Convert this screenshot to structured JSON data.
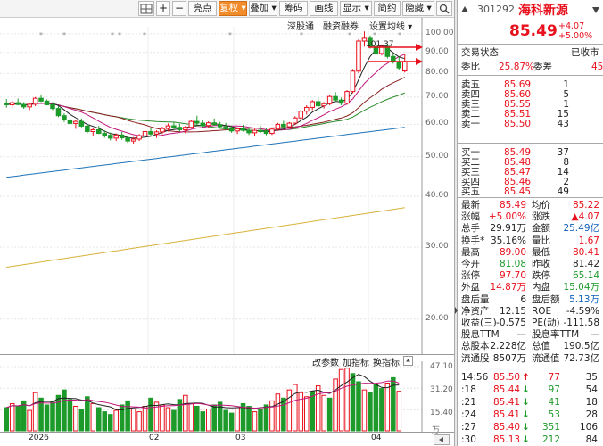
{
  "toolbar": {
    "buttons": [
      {
        "label": "",
        "icon": "grid-icon"
      },
      {
        "label": "+",
        "icon": "zoom-in-icon"
      },
      {
        "label": "−",
        "icon": "zoom-out-icon"
      },
      {
        "label": "亮点"
      },
      {
        "label": "复权 ▾",
        "active": true
      },
      {
        "label": "叠加 ▾"
      },
      {
        "label": "筹码"
      },
      {
        "label": "画线"
      },
      {
        "label": "显示 ▾"
      },
      {
        "label": "简约"
      },
      {
        "label": "隐藏 ▾"
      },
      {
        "label": "",
        "icon": "search-icon"
      }
    ]
  },
  "chart_tabs": [
    "深股通",
    "融资融券",
    "设置均线 ▾"
  ],
  "price_axis": [
    "100.00",
    "90.00",
    "80.00",
    "70.00",
    "60.00",
    "50.00",
    "40.00",
    "30.00",
    "20.00"
  ],
  "peak_label": "101.37",
  "volume_toolbar": [
    "改参数",
    "加指标",
    "换指标"
  ],
  "volume_axis": [
    "47.10",
    "31.20",
    "15.40",
    "万"
  ],
  "date_labels": [
    "2026",
    "02",
    "03",
    "04"
  ],
  "colors": {
    "up": "#e8101c",
    "down": "#1c9a2a",
    "ma5": "#222222",
    "ma10": "#c2177c",
    "ma20": "#8b2020",
    "ma30": "#2a8a2a",
    "ma60": "#1e73b8",
    "ma120": "#d8b23a"
  },
  "header": {
    "code": "301292",
    "name": "海科新源"
  },
  "quote": {
    "price": "85.49",
    "change": "+4.07",
    "pct": "+5.00%"
  },
  "status": {
    "label": "交易状态",
    "value": "已收市"
  },
  "ratio": {
    "wb_label": "委比",
    "wb_value": "25.87%",
    "wc_label": "委差",
    "wc_value": "45"
  },
  "asks": [
    {
      "label": "卖五",
      "price": "85.69",
      "vol": "1"
    },
    {
      "label": "卖四",
      "price": "85.60",
      "vol": "5"
    },
    {
      "label": "卖三",
      "price": "85.55",
      "vol": "1"
    },
    {
      "label": "卖二",
      "price": "85.51",
      "vol": "15"
    },
    {
      "label": "卖一",
      "price": "85.50",
      "vol": "43"
    }
  ],
  "bids": [
    {
      "label": "买一",
      "price": "85.49",
      "vol": "37"
    },
    {
      "label": "买二",
      "price": "85.48",
      "vol": "8"
    },
    {
      "label": "买三",
      "price": "85.47",
      "vol": "14"
    },
    {
      "label": "买四",
      "price": "85.46",
      "vol": "2"
    },
    {
      "label": "买五",
      "price": "85.45",
      "vol": "49"
    }
  ],
  "stats": [
    {
      "l1": "最新",
      "v1": "85.49",
      "c1": "red",
      "l2": "均价",
      "v2": "85.22",
      "c2": "red"
    },
    {
      "l1": "涨幅",
      "v1": "+5.00%",
      "c1": "red",
      "l2": "涨跌",
      "v2": "▲4.07",
      "c2": "red"
    },
    {
      "l1": "总手",
      "v1": "29.91万",
      "c1": "dark",
      "l2": "金额",
      "v2": "25.49亿",
      "c2": "blue"
    },
    {
      "l1": "换手*",
      "v1": "35.16%",
      "c1": "dark",
      "l2": "量比",
      "v2": "1.67",
      "c2": "red"
    },
    {
      "l1": "最高",
      "v1": "89.00",
      "c1": "red",
      "l2": "最低",
      "v2": "80.41",
      "c2": "red"
    },
    {
      "l1": "今开",
      "v1": "81.08",
      "c1": "green",
      "l2": "昨收",
      "v2": "81.42",
      "c2": "dark"
    },
    {
      "l1": "涨停",
      "v1": "97.70",
      "c1": "red",
      "l2": "跌停",
      "v2": "65.14",
      "c2": "green"
    },
    {
      "l1": "外盘",
      "v1": "14.87万",
      "c1": "red",
      "l2": "内盘",
      "v2": "15.04万",
      "c2": "green"
    },
    {
      "l1": "盘后量",
      "v1": "6",
      "c1": "dark",
      "l2": "盘后额",
      "v2": "5.13万",
      "c2": "blue"
    },
    {
      "l1": "净资产",
      "v1": "12.15",
      "c1": "dark",
      "l2": "ROE",
      "v2": "-4.59%",
      "c2": "dark"
    },
    {
      "l1": "收益(三)",
      "v1": "-0.575",
      "c1": "dark",
      "l2": "PE(动)",
      "v2": "-111.58",
      "c2": "dark"
    },
    {
      "l1": "股息TTM",
      "v1": "—",
      "c1": "dark",
      "l2": "股息率TTM",
      "v2": "—",
      "c2": "dark"
    },
    {
      "l1": "总股本",
      "v1": "2.228亿",
      "c1": "dark",
      "l2": "总值",
      "v2": "190.5亿",
      "c2": "dark"
    },
    {
      "l1": "流通股",
      "v1": "8507万",
      "c1": "dark",
      "l2": "流通值",
      "v2": "72.73亿",
      "c2": "dark"
    }
  ],
  "ticks": [
    {
      "time": "14:56",
      "price": "85.50",
      "arrow": "↑",
      "color": "red",
      "vol": "77",
      "num": "35"
    },
    {
      "time": ":18",
      "price": "85.44",
      "arrow": "↓",
      "color": "green",
      "vol": "97",
      "num": "54"
    },
    {
      "time": ":21",
      "price": "85.41",
      "arrow": "↓",
      "color": "green",
      "vol": "41",
      "num": "18"
    },
    {
      "time": ":24",
      "price": "85.41",
      "arrow": "↓",
      "color": "green",
      "vol": "53",
      "num": "28"
    },
    {
      "time": ":27",
      "price": "85.40",
      "arrow": "↓",
      "color": "green",
      "vol": "351",
      "num": "106"
    },
    {
      "time": ":30",
      "price": "85.13",
      "arrow": "↓",
      "color": "green",
      "vol": "212",
      "num": "84"
    }
  ],
  "chart_data": {
    "type": "candlestick",
    "y_scale": "log",
    "ylim": [
      17,
      103
    ],
    "candles": [
      {
        "o": 67.5,
        "h": 69.2,
        "l": 65.9,
        "c": 67.0
      },
      {
        "o": 67.0,
        "h": 68.5,
        "l": 66.0,
        "c": 67.8
      },
      {
        "o": 67.8,
        "h": 69.4,
        "l": 66.8,
        "c": 67.1
      },
      {
        "o": 67.1,
        "h": 68.0,
        "l": 65.5,
        "c": 66.2
      },
      {
        "o": 66.2,
        "h": 67.5,
        "l": 65.0,
        "c": 67.2
      },
      {
        "o": 67.2,
        "h": 70.0,
        "l": 66.5,
        "c": 69.5
      },
      {
        "o": 69.5,
        "h": 71.0,
        "l": 68.0,
        "c": 68.4
      },
      {
        "o": 68.4,
        "h": 69.0,
        "l": 66.8,
        "c": 67.0
      },
      {
        "o": 67.0,
        "h": 68.0,
        "l": 65.0,
        "c": 65.6
      },
      {
        "o": 65.6,
        "h": 66.5,
        "l": 62.5,
        "c": 63.0
      },
      {
        "o": 63.0,
        "h": 63.8,
        "l": 60.8,
        "c": 61.5
      },
      {
        "o": 61.5,
        "h": 62.8,
        "l": 59.8,
        "c": 60.3
      },
      {
        "o": 60.3,
        "h": 61.5,
        "l": 58.5,
        "c": 61.0
      },
      {
        "o": 61.0,
        "h": 62.0,
        "l": 59.0,
        "c": 59.4
      },
      {
        "o": 59.4,
        "h": 60.2,
        "l": 57.0,
        "c": 57.6
      },
      {
        "o": 57.6,
        "h": 58.8,
        "l": 56.0,
        "c": 58.2
      },
      {
        "o": 58.2,
        "h": 59.5,
        "l": 56.8,
        "c": 57.0
      },
      {
        "o": 57.0,
        "h": 58.0,
        "l": 55.6,
        "c": 56.4
      },
      {
        "o": 56.4,
        "h": 57.3,
        "l": 54.8,
        "c": 55.5
      },
      {
        "o": 55.5,
        "h": 57.0,
        "l": 54.6,
        "c": 56.5
      },
      {
        "o": 56.5,
        "h": 57.5,
        "l": 55.0,
        "c": 55.6
      },
      {
        "o": 55.6,
        "h": 56.3,
        "l": 54.0,
        "c": 54.6
      },
      {
        "o": 54.6,
        "h": 55.8,
        "l": 53.8,
        "c": 55.2
      },
      {
        "o": 55.2,
        "h": 56.8,
        "l": 54.6,
        "c": 56.2
      },
      {
        "o": 56.2,
        "h": 58.2,
        "l": 55.6,
        "c": 57.6
      },
      {
        "o": 57.6,
        "h": 58.8,
        "l": 56.2,
        "c": 56.8
      },
      {
        "o": 56.8,
        "h": 58.0,
        "l": 55.6,
        "c": 57.5
      },
      {
        "o": 57.5,
        "h": 59.2,
        "l": 56.8,
        "c": 58.6
      },
      {
        "o": 58.6,
        "h": 60.3,
        "l": 57.6,
        "c": 59.5
      },
      {
        "o": 59.5,
        "h": 60.8,
        "l": 58.5,
        "c": 59.0
      },
      {
        "o": 59.0,
        "h": 60.2,
        "l": 57.6,
        "c": 58.2
      },
      {
        "o": 58.2,
        "h": 59.5,
        "l": 57.0,
        "c": 59.0
      },
      {
        "o": 59.0,
        "h": 61.5,
        "l": 58.6,
        "c": 61.0
      },
      {
        "o": 61.0,
        "h": 63.0,
        "l": 60.0,
        "c": 60.4
      },
      {
        "o": 60.4,
        "h": 61.5,
        "l": 59.0,
        "c": 59.6
      },
      {
        "o": 59.6,
        "h": 61.0,
        "l": 58.8,
        "c": 60.5
      },
      {
        "o": 60.5,
        "h": 62.0,
        "l": 59.6,
        "c": 59.9
      },
      {
        "o": 59.9,
        "h": 60.8,
        "l": 58.5,
        "c": 59.2
      },
      {
        "o": 59.2,
        "h": 60.5,
        "l": 58.0,
        "c": 58.6
      },
      {
        "o": 58.6,
        "h": 59.6,
        "l": 57.2,
        "c": 57.8
      },
      {
        "o": 57.8,
        "h": 59.0,
        "l": 56.8,
        "c": 58.5
      },
      {
        "o": 58.5,
        "h": 59.8,
        "l": 57.6,
        "c": 58.0
      },
      {
        "o": 58.0,
        "h": 59.0,
        "l": 56.5,
        "c": 57.2
      },
      {
        "o": 57.2,
        "h": 58.5,
        "l": 56.0,
        "c": 58.0
      },
      {
        "o": 58.0,
        "h": 59.5,
        "l": 57.2,
        "c": 57.6
      },
      {
        "o": 57.6,
        "h": 58.6,
        "l": 56.4,
        "c": 57.0
      },
      {
        "o": 57.0,
        "h": 58.8,
        "l": 56.5,
        "c": 58.4
      },
      {
        "o": 58.4,
        "h": 60.5,
        "l": 57.8,
        "c": 60.0
      },
      {
        "o": 60.0,
        "h": 61.2,
        "l": 58.8,
        "c": 59.2
      },
      {
        "o": 59.2,
        "h": 60.8,
        "l": 58.6,
        "c": 60.4
      },
      {
        "o": 60.4,
        "h": 62.8,
        "l": 59.8,
        "c": 62.2
      },
      {
        "o": 62.2,
        "h": 65.0,
        "l": 61.6,
        "c": 64.6
      },
      {
        "o": 64.6,
        "h": 66.8,
        "l": 63.4,
        "c": 66.0
      },
      {
        "o": 66.0,
        "h": 68.8,
        "l": 65.0,
        "c": 68.2
      },
      {
        "o": 68.2,
        "h": 69.8,
        "l": 66.0,
        "c": 66.6
      },
      {
        "o": 66.6,
        "h": 68.0,
        "l": 65.6,
        "c": 67.4
      },
      {
        "o": 67.4,
        "h": 70.8,
        "l": 66.8,
        "c": 70.2
      },
      {
        "o": 70.2,
        "h": 72.0,
        "l": 68.2,
        "c": 68.8
      },
      {
        "o": 68.8,
        "h": 69.8,
        "l": 66.8,
        "c": 67.6
      },
      {
        "o": 67.6,
        "h": 72.8,
        "l": 67.0,
        "c": 72.2
      },
      {
        "o": 72.2,
        "h": 82.0,
        "l": 71.5,
        "c": 81.0
      },
      {
        "o": 81.0,
        "h": 97.0,
        "l": 80.0,
        "c": 96.0
      },
      {
        "o": 96.0,
        "h": 101.37,
        "l": 93.0,
        "c": 97.5
      },
      {
        "o": 97.5,
        "h": 99.0,
        "l": 92.0,
        "c": 93.0
      },
      {
        "o": 93.0,
        "h": 94.5,
        "l": 88.5,
        "c": 89.5
      },
      {
        "o": 89.5,
        "h": 94.0,
        "l": 88.5,
        "c": 93.2
      },
      {
        "o": 93.2,
        "h": 94.5,
        "l": 87.0,
        "c": 88.0
      },
      {
        "o": 88.0,
        "h": 89.5,
        "l": 84.5,
        "c": 85.5
      },
      {
        "o": 85.5,
        "h": 88.0,
        "l": 81.5,
        "c": 82.5
      },
      {
        "o": 81.08,
        "h": 89.0,
        "l": 80.41,
        "c": 85.49
      }
    ],
    "volume": [
      17,
      20,
      18,
      22,
      15,
      28,
      24,
      19,
      21,
      26,
      30,
      23,
      18,
      16,
      25,
      20,
      17,
      14,
      12,
      15,
      19,
      22,
      16,
      14,
      18,
      24,
      21,
      19,
      17,
      15,
      23,
      26,
      20,
      18,
      14,
      16,
      19,
      21,
      15,
      13,
      17,
      20,
      18,
      14,
      16,
      19,
      22,
      27,
      24,
      30,
      34,
      28,
      25,
      29,
      33,
      26,
      24,
      38,
      45,
      46,
      42,
      36,
      30,
      28,
      34,
      31,
      35,
      39,
      29
    ],
    "volume_up": [
      0,
      1,
      0,
      0,
      1,
      1,
      0,
      0,
      0,
      0,
      0,
      0,
      1,
      0,
      0,
      1,
      0,
      0,
      0,
      1,
      0,
      0,
      1,
      1,
      1,
      0,
      1,
      1,
      1,
      0,
      0,
      1,
      1,
      0,
      0,
      1,
      0,
      0,
      0,
      0,
      1,
      0,
      0,
      1,
      0,
      0,
      1,
      1,
      0,
      1,
      1,
      1,
      1,
      0,
      1,
      1,
      0,
      1,
      1,
      1,
      0,
      0,
      1,
      0,
      0,
      0,
      1,
      0,
      1
    ]
  }
}
